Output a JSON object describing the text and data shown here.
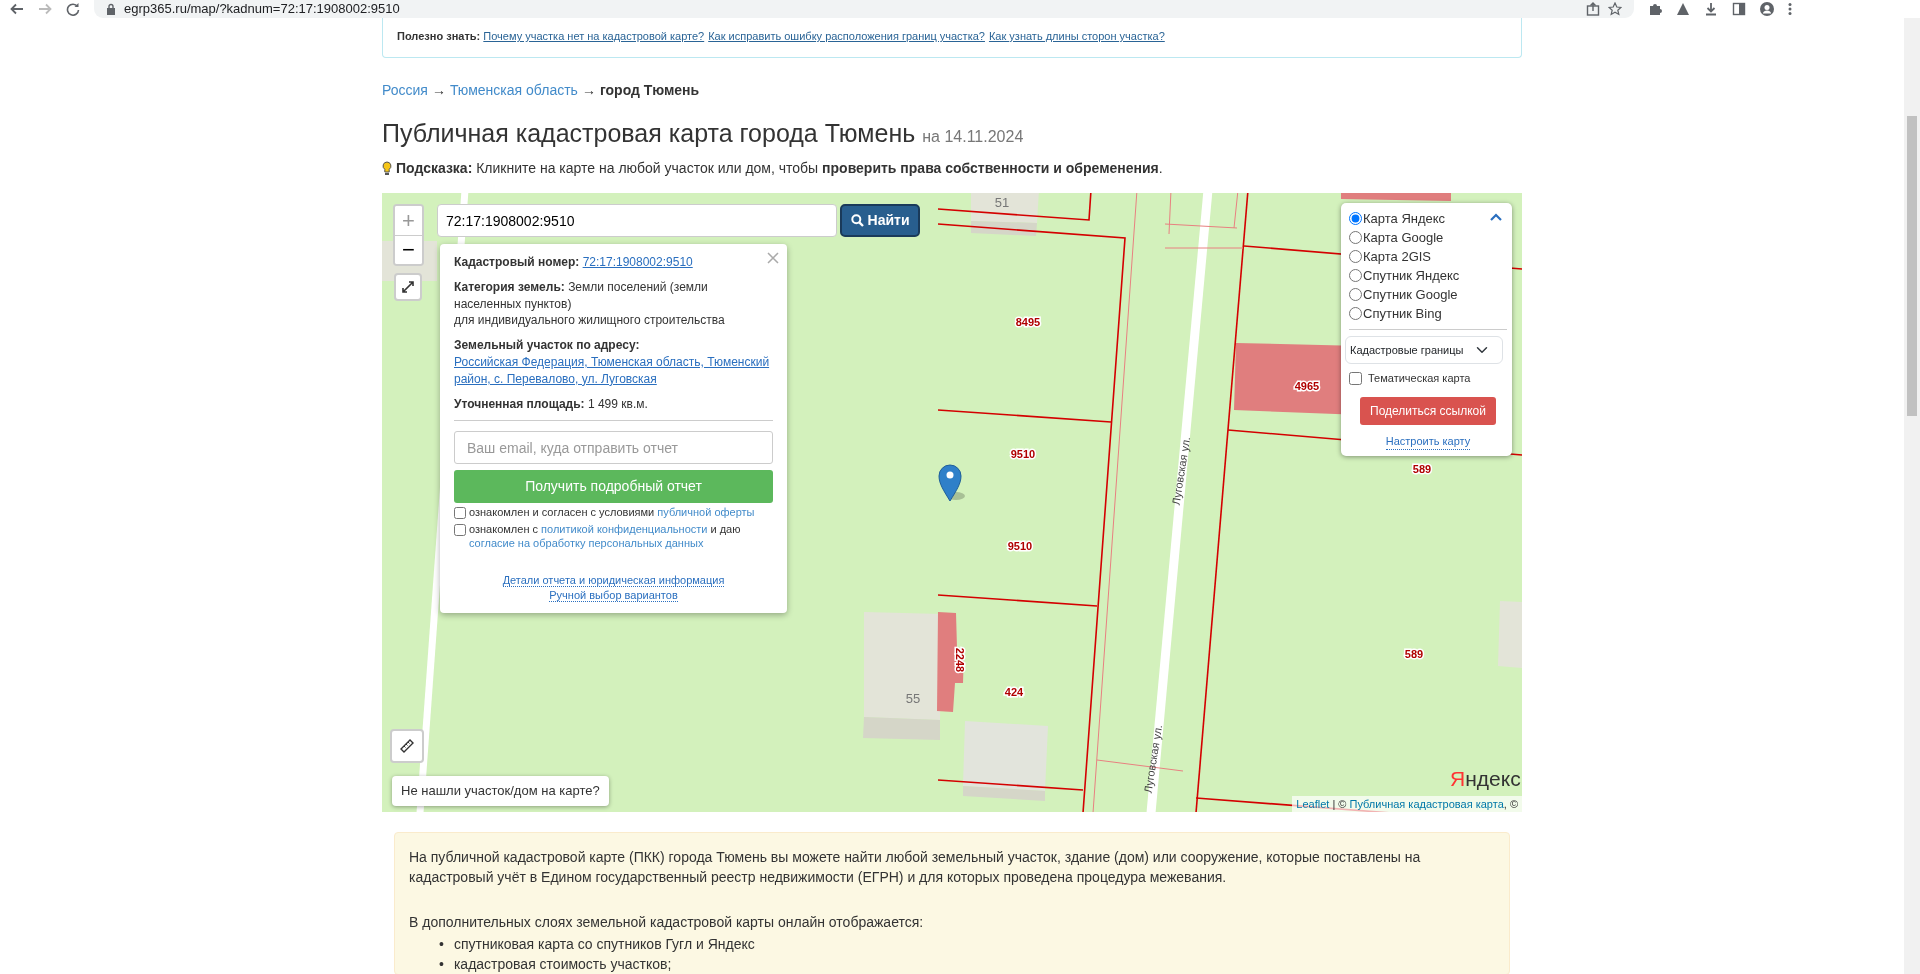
{
  "browser": {
    "url": "egrp365.ru/map/?kadnum=72:17:1908002:9510"
  },
  "notice": {
    "label": "Полезно знать:",
    "links": [
      "Почему участка нет на кадастровой карте?",
      "Как исправить ошибку расположения границ участка?",
      "Как узнать длины сторон участка?"
    ]
  },
  "breadcrumb": {
    "items": [
      {
        "text": "Россия",
        "current": false
      },
      {
        "text": "Тюменская область",
        "current": false
      },
      {
        "text": "город Тюмень",
        "current": true
      }
    ],
    "separators": [
      "→",
      "→"
    ]
  },
  "title": "Публичная кадастровая карта города Тюмень",
  "date": "на 14.11.2024",
  "hint": "**Подсказка:** Кликните на карте на любой участок или дом, чтобы **проверить права собственности и обременения**.",
  "map": {
    "zoom": {
      "in": "+",
      "out": "−"
    },
    "search": {
      "value": "72:17:1908002:9510",
      "button": "Найти"
    },
    "popup": {
      "fields": [
        {
          "kind": "link",
          "label": "Кадастровый номер:",
          "value": "72:17:1908002:9510"
        },
        {
          "kind": "text",
          "label": "Категория земель:",
          "lines": [
            "Земли поселений (земли населенных пунктов)",
            "для индивидуального жилищного строительства"
          ]
        },
        {
          "kind": "link",
          "label": "Земельный участок по адресу:",
          "value": "Российская Федерация, Тюменская область, Тюменский район, с. Перевалово, ул. Луговская"
        },
        {
          "kind": "text",
          "label": "Уточненная площадь:",
          "lines": [
            "1 499 кв.м."
          ]
        }
      ],
      "email_placeholder": "Ваш email, куда отправить отчет",
      "submit": "Получить подробный отчет",
      "agreements": [
        {
          "checked": false,
          "parts": [
            {
              "text": "ознакомлен и согласен с условиями ",
              "kind": "text"
            },
            {
              "text": "публичной оферты",
              "kind": "link"
            }
          ]
        },
        {
          "checked": false,
          "parts": [
            {
              "text": "ознакомлен с ",
              "kind": "text"
            },
            {
              "text": "политикой конфиденциальности",
              "kind": "link"
            },
            {
              "text": " и даю ",
              "kind": "text"
            },
            {
              "text": "согласие на обработку персональных данных",
              "kind": "link"
            }
          ]
        }
      ],
      "links": [
        "Детали отчета и юридическая информация",
        "Ручной выбор вариантов"
      ]
    },
    "layers": {
      "options": [
        {
          "label": "Карта Яндекс",
          "selected": true
        },
        {
          "label": "Карта Google",
          "selected": false
        },
        {
          "label": "Карта 2GIS",
          "selected": false
        },
        {
          "label": "Спутник Яндекс",
          "selected": false
        },
        {
          "label": "Спутник Google",
          "selected": false
        },
        {
          "label": "Спутник Bing",
          "selected": false
        }
      ],
      "overlay": "Кадастровые границы",
      "thematic": {
        "label": "Тематическая карта",
        "checked": false
      },
      "share": "Поделиться ссылкой",
      "settings": "Настроить карту"
    },
    "plot_labels": [
      "8495",
      "9510",
      "9510",
      "424",
      "2248",
      "4965",
      "589",
      "589"
    ],
    "house_numbers": [
      "51",
      "55"
    ],
    "street_labels": [
      "Луговская ул.",
      "Луговская ул."
    ],
    "not_found": "Не нашли участок/дом на карте?",
    "logo": "Яндекс",
    "attribution": [
      {
        "text": "Leaflet",
        "kind": "link"
      },
      {
        "text": " | © ",
        "kind": "text"
      },
      {
        "text": "Публичная кадастровая карта",
        "kind": "link"
      },
      {
        "text": ", ©",
        "kind": "text"
      }
    ]
  },
  "info": {
    "paragraphs": [
      "На публичной кадастровой карте (ПКК) города Тюмень вы можете найти любой земельный участок, здание (дом) или сооружение, которые поставлены на кадастровый учёт в Едином государственный реестр недвижимости (ЕГРН) и для которых проведена процедура межевания.",
      "В дополнительных слоях земельной кадастровой карты онлайн отображается:"
    ],
    "list": [
      {
        "marker": "•",
        "text": "спутниковая карта со спутников Гугл и Яндекс"
      },
      {
        "marker": "•",
        "text": "кадастровая стоимость участков;"
      }
    ]
  }
}
